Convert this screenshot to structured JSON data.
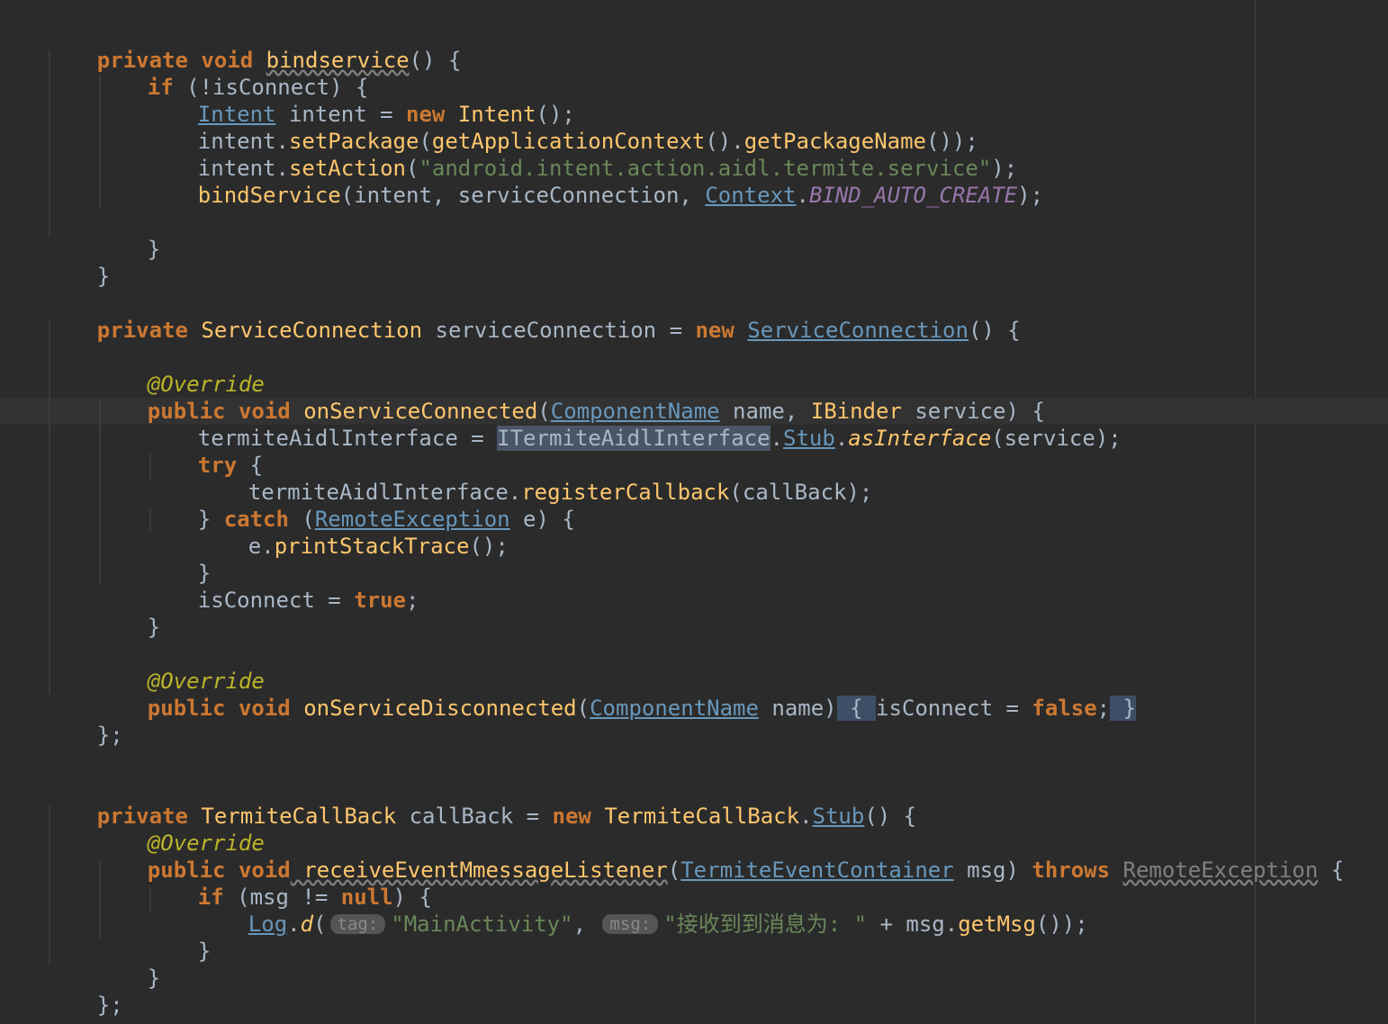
{
  "editor": {
    "theme_colors": {
      "background": "#2b2b2b",
      "keyword": "#cc7832",
      "method": "#ffc66d",
      "string": "#6a8759",
      "annotation": "#bbb529",
      "static_field": "#9876aa",
      "class_ref": "#6897bb",
      "default_text": "#a9b7c6"
    },
    "code": {
      "l1": {
        "kw1": "private",
        "kw2": "void",
        "fn": "bindservice",
        "rest": "() {"
      },
      "l2": {
        "kw": "if",
        "rest": " (!isConnect) {"
      },
      "l3": {
        "type": "Intent",
        "mid": " intent = ",
        "kw": "new",
        "fn": " Intent",
        "rest": "();"
      },
      "l4": {
        "a": "intent.",
        "fn1": "setPackage",
        "b": "(",
        "fn2": "getApplicationContext",
        "c": "().",
        "fn3": "getPackageName",
        "d": "());"
      },
      "l5": {
        "a": "intent.",
        "fn": "setAction",
        "b": "(",
        "str": "\"android.intent.action.aidl.termite.service\"",
        "c": ");"
      },
      "l6": {
        "fn": "bindService",
        "a": "(intent, serviceConnection, ",
        "cls": "Context",
        "dot": ".",
        "stat": "BIND_AUTO_CREATE",
        "b": ");"
      },
      "l7": {
        "text": "}"
      },
      "l8": {
        "text": "}"
      },
      "l9": {
        "kw": "private",
        "cls": " ServiceConnection",
        "a": " serviceConnection = ",
        "kw2": "new",
        "sp": " ",
        "ref": "ServiceConnection",
        "b": "() {"
      },
      "l10": {
        "ann": "@Override"
      },
      "l11": {
        "kw1": "public",
        "kw2": "void",
        "fn": " onServiceConnected",
        "a": "(",
        "ref": "ComponentName",
        "b": " name, ",
        "cls": "IBinder",
        "c": " service) {"
      },
      "l12": {
        "a": "termiteAidlInterface = ",
        "sel": "ITermiteAidlInterface",
        "dot": ".",
        "ref": "Stub",
        "dot2": ".",
        "fn": "asInterface",
        "b": "(service);"
      },
      "l13": {
        "kw": "try",
        "rest": " {"
      },
      "l14": {
        "a": "termiteAidlInterface.",
        "fn": "registerCallback",
        "b": "(callBack);"
      },
      "l15": {
        "a": "} ",
        "kw": "catch",
        "b": " (",
        "ref": "RemoteException",
        "c": " e) {"
      },
      "l16": {
        "a": "e.",
        "fn": "printStackTrace",
        "b": "();"
      },
      "l17": {
        "text": "}"
      },
      "l18": {
        "a": "isConnect = ",
        "kw": "true",
        "b": ";"
      },
      "l19": {
        "text": "}"
      },
      "l20": {
        "ann": "@Override"
      },
      "l21": {
        "kw1": "public",
        "kw2": "void",
        "fn": " onServiceDisconnected",
        "a": "(",
        "ref": "ComponentName",
        "b": " name)",
        "fold1": " { ",
        "c": "isConnect = ",
        "kw3": "false",
        "d": ";",
        "fold2": " }"
      },
      "l22": {
        "text": "};"
      },
      "l23": {
        "kw": "private",
        "cls": " TermiteCallBack",
        "a": " callBack = ",
        "kw2": "new",
        "cls2": " TermiteCallBack",
        "dot": ".",
        "ref": "Stub",
        "b": "() {"
      },
      "l24": {
        "ann": "@Override"
      },
      "l25": {
        "kw1": "public",
        "kw2": "void",
        "fn": " receiveEventMmessageListener",
        "a": "(",
        "ref": "TermiteEventContainer",
        "b": " msg) ",
        "kw3": "throws",
        "sp": " ",
        "gray": "RemoteException",
        "c": " {"
      },
      "l26": {
        "kw": "if",
        "a": " (msg != ",
        "kw2": "null",
        "b": ") {"
      },
      "l27": {
        "ref": "Log",
        "dot": ".",
        "fn": "d",
        "a": "(",
        "hint1": "tag:",
        "str1": "\"MainActivity\"",
        "b": ", ",
        "hint2": "msg:",
        "str2": "\"接收到到消息为: \"",
        "c": " + msg.",
        "fn2": "getMsg",
        "d": "());"
      },
      "l28": {
        "text": "}"
      },
      "l29": {
        "text": "}"
      },
      "l30": {
        "text": "};"
      }
    }
  }
}
